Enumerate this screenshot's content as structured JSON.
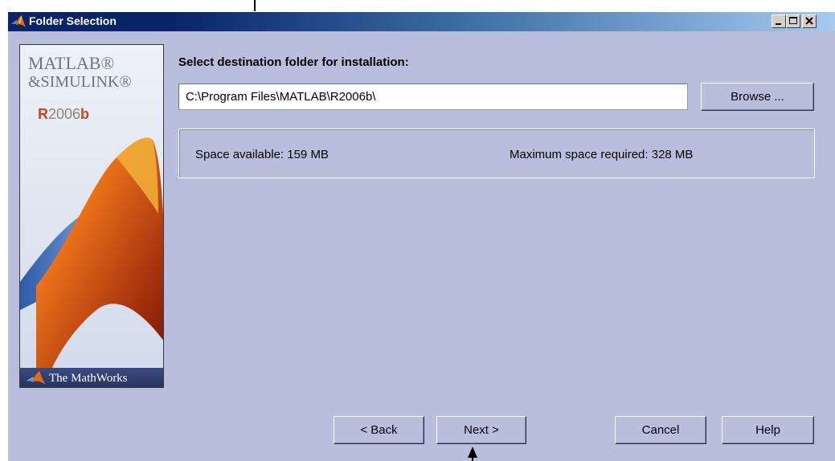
{
  "window": {
    "title": "Folder Selection",
    "controls": [
      "minimize",
      "maximize",
      "close"
    ]
  },
  "branding": {
    "line1": "MATLAB®",
    "line2": "&SIMULINK®",
    "release_prefix": "R",
    "release_number": "2006",
    "release_suffix": "b",
    "company": "The MathWorks"
  },
  "form": {
    "prompt": "Select destination folder for installation:",
    "folder_value": "C:\\Program Files\\MATLAB\\R2006b\\",
    "browse_label": "Browse ..."
  },
  "space": {
    "available": "Space available: 159 MB",
    "required": "Maximum space required: 328 MB"
  },
  "footer": {
    "back_label": "< Back",
    "next_label": "Next >",
    "cancel_label": "Cancel",
    "help_label": "Help"
  },
  "colors": {
    "window_bg": "#b8bedc",
    "titlebar_start": "#0a246a",
    "titlebar_end": "#a6caf0"
  }
}
